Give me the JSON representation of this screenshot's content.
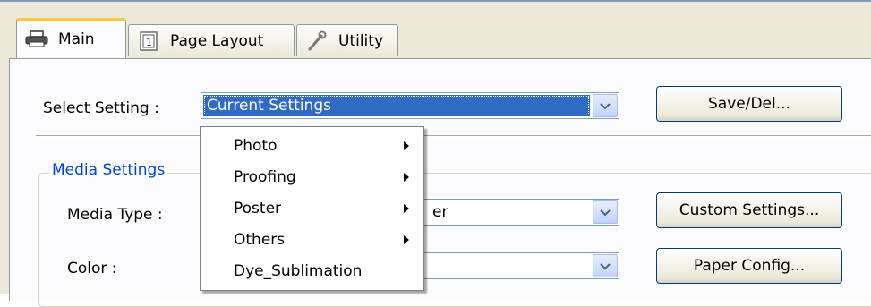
{
  "tabs": [
    {
      "label": "Main",
      "icon": "printer-icon",
      "active": true
    },
    {
      "label": "Page Layout",
      "icon": "page-layout-icon",
      "active": false
    },
    {
      "label": "Utility",
      "icon": "wrench-icon",
      "active": false
    }
  ],
  "select_setting": {
    "label": "Select Setting :",
    "value": "Current Settings",
    "button": "Save/Del..."
  },
  "media_settings": {
    "title": "Media Settings",
    "media_type": {
      "label": "Media Type :",
      "value_partial": "er",
      "button": "Custom Settings..."
    },
    "color": {
      "label": "Color :",
      "value": "",
      "button": "Paper Config..."
    }
  },
  "popup_menu": {
    "items": [
      {
        "label": "Photo",
        "has_submenu": true
      },
      {
        "label": "Proofing",
        "has_submenu": true
      },
      {
        "label": "Poster",
        "has_submenu": true
      },
      {
        "label": "Others",
        "has_submenu": true
      },
      {
        "label": "Dye_Sublimation",
        "has_submenu": false
      }
    ]
  },
  "colors": {
    "selection": "#316ac5",
    "group_title": "#0046d5",
    "tab_highlight": "#ffc83c"
  }
}
